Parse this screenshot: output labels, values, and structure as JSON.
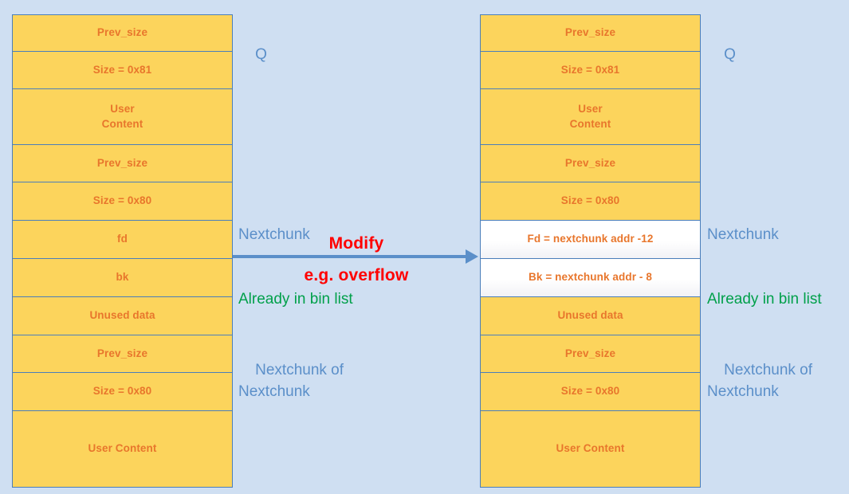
{
  "diagram": {
    "title": "Heap chunk unlink modification diagram",
    "colors": {
      "background": "#cfdff2",
      "chunk_fill": "#fcd45c",
      "chunk_border": "#4a7ebb",
      "chunk_text": "#e8762c",
      "annotation_blue": "#5b8fc9",
      "annotation_green": "#00a04a",
      "arrow": "#5b8fc9",
      "modify_text": "#ff0000",
      "pointer_row_fill": "#ffffff"
    }
  },
  "left_column": {
    "name": "before-modification",
    "rows": [
      {
        "label": "Prev_size",
        "kind": "field"
      },
      {
        "label": "Size = 0x81",
        "kind": "field"
      },
      {
        "label": "User\nContent",
        "kind": "field"
      },
      {
        "label": "Prev_size",
        "kind": "field"
      },
      {
        "label": "Size = 0x80",
        "kind": "field"
      },
      {
        "label": "fd",
        "kind": "pointer"
      },
      {
        "label": "bk",
        "kind": "pointer"
      },
      {
        "label": "Unused data",
        "kind": "field"
      },
      {
        "label": "Prev_size",
        "kind": "field"
      },
      {
        "label": "Size = 0x80",
        "kind": "field"
      },
      {
        "label": "User Content",
        "kind": "field"
      }
    ]
  },
  "right_column": {
    "name": "after-modification",
    "rows": [
      {
        "label": "Prev_size",
        "kind": "field"
      },
      {
        "label": "Size = 0x81",
        "kind": "field"
      },
      {
        "label": "User\nContent",
        "kind": "field"
      },
      {
        "label": "Prev_size",
        "kind": "field"
      },
      {
        "label": "Size = 0x80",
        "kind": "field"
      },
      {
        "label": "Fd = nextchunk addr -12",
        "kind": "pointer"
      },
      {
        "label": "Bk = nextchunk addr - 8",
        "kind": "pointer"
      },
      {
        "label": "Unused data",
        "kind": "field"
      },
      {
        "label": "Prev_size",
        "kind": "field"
      },
      {
        "label": "Size = 0x80",
        "kind": "field"
      },
      {
        "label": "User Content",
        "kind": "field"
      }
    ]
  },
  "annotations": {
    "left": {
      "q": "Q",
      "nextchunk": "Nextchunk",
      "already_in_bin_list": "Already in bin list",
      "nextchunk_of_nextchunk": "Nextchunk of\nNextchunk"
    },
    "right": {
      "q": "Q",
      "nextchunk": "Nextchunk",
      "already_in_bin_list": "Already in bin list",
      "nextchunk_of_nextchunk": "Nextchunk of\nNextchunk"
    }
  },
  "arrow": {
    "label_top": "Modify",
    "label_bottom": "e.g. overflow",
    "direction": "left-to-right"
  }
}
